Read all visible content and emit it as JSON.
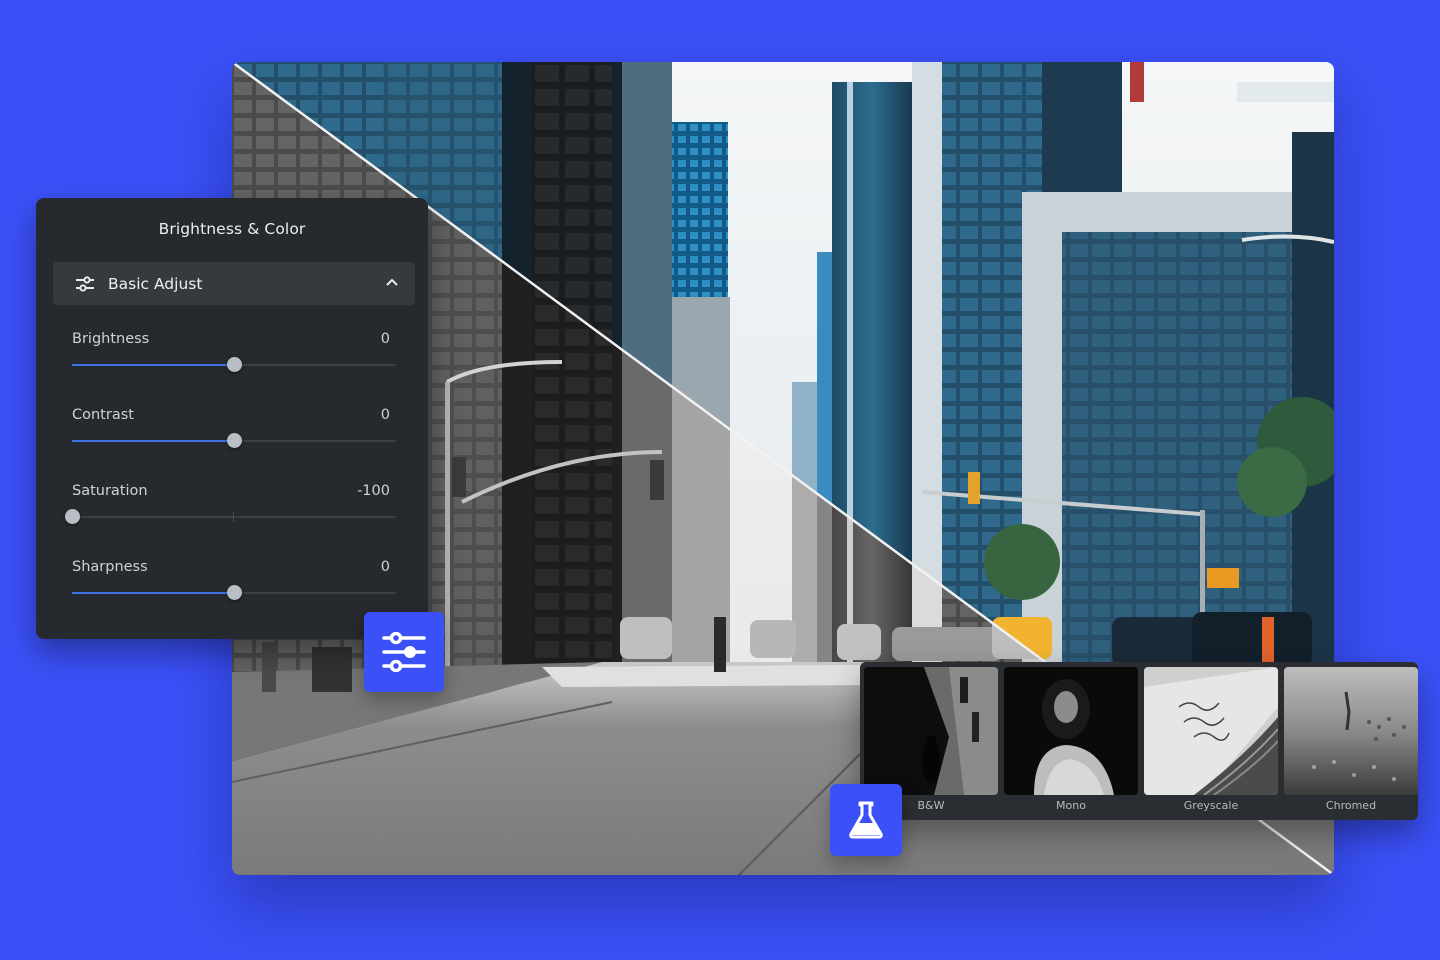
{
  "colors": {
    "background": "#3b50f6",
    "accent": "#3b50f6",
    "panel_bg": "#26292d",
    "slider_fill": "#3c72e6"
  },
  "photo": {
    "subject": "city street with skyscrapers",
    "split": "diagonal before/after",
    "left_side": "greyscale",
    "right_side": "color"
  },
  "panel": {
    "title": "Brightness & Color",
    "section": {
      "label": "Basic Adjust",
      "icon": "tune-icon",
      "state_icon": "chevron-up-icon",
      "expanded": true
    },
    "sliders": [
      {
        "label": "Brightness",
        "value": "0",
        "min": -100,
        "max": 100,
        "current": 0
      },
      {
        "label": "Contrast",
        "value": "0",
        "min": -100,
        "max": 100,
        "current": 0
      },
      {
        "label": "Saturation",
        "value": "-100",
        "min": -100,
        "max": 100,
        "current": -100
      },
      {
        "label": "Sharpness",
        "value": "0",
        "min": -100,
        "max": 100,
        "current": 0
      }
    ]
  },
  "buttons": {
    "adjust": {
      "icon": "sliders-icon"
    },
    "filters": {
      "icon": "flask-icon"
    }
  },
  "filters": [
    {
      "label": "B&W"
    },
    {
      "label": "Mono"
    },
    {
      "label": "Greyscale"
    },
    {
      "label": "Chromed"
    }
  ]
}
